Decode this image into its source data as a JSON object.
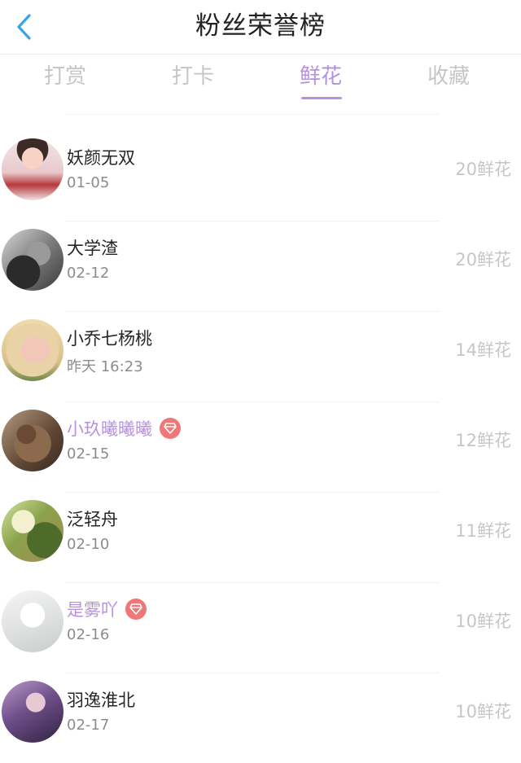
{
  "header": {
    "title": "粉丝荣誉榜",
    "back_icon": "chevron-left-icon",
    "accent_color": "#3aa3e3"
  },
  "tabs": [
    {
      "label": "打赏",
      "active": false
    },
    {
      "label": "打卡",
      "active": false
    },
    {
      "label": "鲜花",
      "active": true
    },
    {
      "label": "收藏",
      "active": false
    }
  ],
  "colors": {
    "active_tab": "#b592df",
    "vip_name": "#b592df",
    "badge": "#f07777",
    "muted": "#c6c6c6"
  },
  "fans": [
    {
      "name": "妖颜无双",
      "date": "01-05",
      "count": "20鲜花",
      "vip": false
    },
    {
      "name": "大学渣",
      "date": "02-12",
      "count": "20鲜花",
      "vip": false
    },
    {
      "name": "小乔七杨桃",
      "date": "昨天 16:23",
      "count": "14鲜花",
      "vip": false
    },
    {
      "name": "小玖曦曦曦",
      "date": "02-15",
      "count": "12鲜花",
      "vip": true,
      "badge_icon": "diamond-icon"
    },
    {
      "name": "泛轻舟",
      "date": "02-10",
      "count": "11鲜花",
      "vip": false
    },
    {
      "name": "是雾吖",
      "date": "02-16",
      "count": "10鲜花",
      "vip": true,
      "badge_icon": "diamond-icon"
    },
    {
      "name": "羽逸淮北",
      "date": "02-17",
      "count": "10鲜花",
      "vip": false
    }
  ]
}
